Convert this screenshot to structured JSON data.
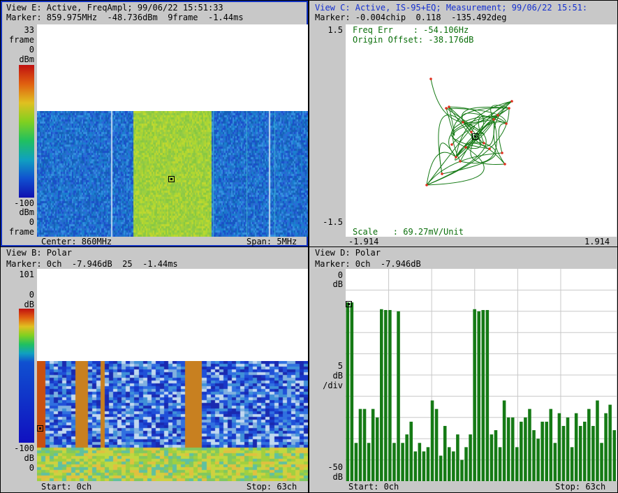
{
  "viewE": {
    "header": "View E: Active, FreqAmpl; 99/06/22 15:51:33",
    "marker": "Marker: 859.975MHz  -48.736dBm  9frame  -1.44ms",
    "frames_top": "33",
    "frames_top_unit": "frame",
    "top_level": "0",
    "top_level_unit": "dBm",
    "bottom_level": "-100",
    "bottom_level_unit": "dBm",
    "frames_bottom": "0",
    "frames_bottom_unit": "frame",
    "center": "Center: 860MHz",
    "span": "Span: 5MHz"
  },
  "viewC": {
    "header": "View C: Active, IS-95+EQ; Measurement; 99/06/22 15:51:",
    "marker": "Marker: -0.004chip  0.118  -135.492deg",
    "y_max": "1.5",
    "y_min": "-1.5",
    "x_min": "-1.914",
    "x_max": "1.914",
    "freq_err": "Freq Err    : -54.106Hz",
    "origin_offset": "Origin Offset: -38.176dB",
    "scale": "Scale   : 69.27mV/Unit"
  },
  "viewB": {
    "header": "View B: Polar",
    "marker": "Marker: 0ch  -7.946dB  25  -1.44ms",
    "frames_top": "101",
    "top_level": "0",
    "top_level_unit": "dB",
    "bottom_level": "-100",
    "bottom_level_unit": "dB",
    "frames_bottom": "0",
    "start": "Start: 0ch",
    "stop": "Stop: 63ch"
  },
  "viewD": {
    "header": "View D: Polar",
    "marker": "Marker: 0ch  -7.946dB",
    "top_level": "0",
    "top_unit": "dB",
    "scale_value": "5",
    "scale_unit": "dB",
    "scale_div": "/div",
    "bottom_level": "-50",
    "bottom_unit": "dB",
    "start": "Start: 0ch",
    "stop": "Stop: 63ch"
  },
  "colors": {
    "panel": "#c8c8c8",
    "active_border": "#1030c0",
    "trace_green": "#157a15",
    "constellation_dot": "#e03020"
  },
  "chart_data": [
    {
      "type": "bar",
      "view": "View D: Polar",
      "categories_label": "ch",
      "x": [
        0,
        1,
        2,
        3,
        4,
        5,
        6,
        7,
        8,
        9,
        10,
        11,
        12,
        13,
        14,
        15,
        16,
        17,
        18,
        19,
        20,
        21,
        22,
        23,
        24,
        25,
        26,
        27,
        28,
        29,
        30,
        31,
        32,
        33,
        34,
        35,
        36,
        37,
        38,
        39,
        40,
        41,
        42,
        43,
        44,
        45,
        46,
        47,
        48,
        49,
        50,
        51,
        52,
        53,
        53,
        54,
        55,
        56,
        57,
        58,
        59,
        60,
        61,
        62,
        63
      ],
      "values": [
        -7.9,
        -7.9,
        -41,
        -33,
        -33,
        -41,
        -33,
        -35,
        -9.5,
        -9.7,
        -9.7,
        -41,
        -10,
        -41,
        -39,
        -36,
        -43,
        -41,
        -43,
        -42,
        -31,
        -33,
        -44,
        -37,
        -42,
        -43,
        -39,
        -45,
        -42,
        -39,
        -9.5,
        -10,
        -9.7,
        -9.7,
        -39,
        -38,
        -42,
        -31,
        -35,
        -35,
        -42,
        -36,
        -35,
        -33,
        -38,
        -40,
        -36,
        -36,
        -33,
        -41,
        -34,
        -37,
        -35,
        -42,
        -34,
        -37,
        -36,
        -33,
        -37,
        -31,
        -41,
        -34,
        -32,
        -38
      ],
      "ylim": [
        -50,
        0
      ],
      "y_scale": "5 dB/div",
      "xlim": [
        0,
        63
      ]
    }
  ]
}
